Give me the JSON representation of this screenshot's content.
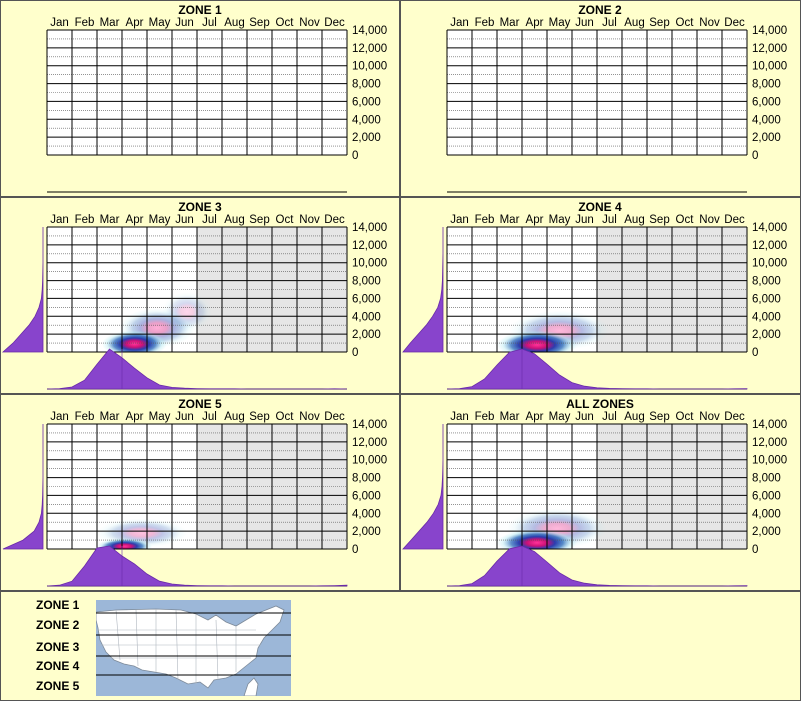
{
  "months": [
    "Jan",
    "Feb",
    "Mar",
    "Apr",
    "May",
    "Jun",
    "Jul",
    "Aug",
    "Sep",
    "Oct",
    "Nov",
    "Dec"
  ],
  "y_tick_labels": [
    "14,000",
    "12,000",
    "10,000",
    "8,000",
    "6,000",
    "4,000",
    "2,000",
    "0"
  ],
  "colors": {
    "background": "#ffffcc",
    "marginal_fill": "#8844cc",
    "shaded_months": "#e6e6e6",
    "density_low": "#aee8f0",
    "density_mid": "#1a5fb4",
    "density_high": "#ff3399"
  },
  "chart_data": [
    {
      "type": "heatmap",
      "title": "ZONE 1",
      "x_categories": [
        "Jan",
        "Feb",
        "Mar",
        "Apr",
        "May",
        "Jun",
        "Jul",
        "Aug",
        "Sep",
        "Oct",
        "Nov",
        "Dec"
      ],
      "ylim": [
        0,
        14000
      ],
      "y_ticks": [
        0,
        2000,
        4000,
        6000,
        8000,
        10000,
        12000,
        14000
      ],
      "grid": true,
      "has_data": false,
      "shaded_months": [],
      "hotspots": [],
      "month_marginal": [],
      "elevation_marginal": []
    },
    {
      "type": "heatmap",
      "title": "ZONE 2",
      "x_categories": [
        "Jan",
        "Feb",
        "Mar",
        "Apr",
        "May",
        "Jun",
        "Jul",
        "Aug",
        "Sep",
        "Oct",
        "Nov",
        "Dec"
      ],
      "ylim": [
        0,
        14000
      ],
      "y_ticks": [
        0,
        2000,
        4000,
        6000,
        8000,
        10000,
        12000,
        14000
      ],
      "grid": true,
      "has_data": false,
      "shaded_months": [],
      "hotspots": [],
      "month_marginal": [],
      "elevation_marginal": []
    },
    {
      "type": "heatmap",
      "title": "ZONE 3",
      "x_categories": [
        "Jan",
        "Feb",
        "Mar",
        "Apr",
        "May",
        "Jun",
        "Jul",
        "Aug",
        "Sep",
        "Oct",
        "Nov",
        "Dec"
      ],
      "ylim": [
        0,
        14000
      ],
      "y_ticks": [
        0,
        2000,
        4000,
        6000,
        8000,
        10000,
        12000,
        14000
      ],
      "grid": true,
      "has_data": true,
      "shaded_months": [
        "Jul",
        "Aug",
        "Sep",
        "Oct",
        "Nov",
        "Dec"
      ],
      "hotspots": [
        {
          "month": 3.5,
          "elev": 900,
          "intensity": 1.0,
          "rx": 1.3,
          "ry": 1500
        },
        {
          "month": 4.4,
          "elev": 2700,
          "intensity": 0.4,
          "rx": 1.5,
          "ry": 2200
        },
        {
          "month": 5.6,
          "elev": 4500,
          "intensity": 0.2,
          "rx": 1.0,
          "ry": 2200
        }
      ],
      "month_marginal": [
        0,
        0.01,
        0.05,
        0.22,
        0.62,
        1.0,
        0.78,
        0.52,
        0.28,
        0.1,
        0.04,
        0.02,
        0.01,
        0.005,
        0.005,
        0.005,
        0,
        0,
        0,
        0,
        0,
        0,
        0,
        0.005,
        0
      ],
      "elevation_marginal": [
        1.0,
        0.75,
        0.55,
        0.35,
        0.2,
        0.1,
        0.04,
        0.02,
        0.01,
        0.005,
        0,
        0,
        0,
        0,
        0
      ]
    },
    {
      "type": "heatmap",
      "title": "ZONE 4",
      "x_categories": [
        "Jan",
        "Feb",
        "Mar",
        "Apr",
        "May",
        "Jun",
        "Jul",
        "Aug",
        "Sep",
        "Oct",
        "Nov",
        "Dec"
      ],
      "ylim": [
        0,
        14000
      ],
      "y_ticks": [
        0,
        2000,
        4000,
        6000,
        8000,
        10000,
        12000,
        14000
      ],
      "grid": true,
      "has_data": true,
      "shaded_months": [
        "Jul",
        "Aug",
        "Sep",
        "Oct",
        "Nov",
        "Dec"
      ],
      "hotspots": [
        {
          "month": 3.6,
          "elev": 800,
          "intensity": 1.0,
          "rx": 1.6,
          "ry": 1600
        },
        {
          "month": 4.5,
          "elev": 2400,
          "intensity": 0.35,
          "rx": 2.0,
          "ry": 2200
        }
      ],
      "month_marginal": [
        0,
        0.01,
        0.06,
        0.25,
        0.6,
        0.92,
        1.0,
        0.88,
        0.62,
        0.35,
        0.16,
        0.07,
        0.03,
        0.015,
        0.01,
        0.005,
        0.005,
        0,
        0,
        0,
        0,
        0,
        0,
        0.005,
        0.01
      ],
      "elevation_marginal": [
        1.0,
        0.82,
        0.62,
        0.42,
        0.26,
        0.13,
        0.06,
        0.03,
        0.015,
        0.01,
        0.005,
        0,
        0,
        0,
        0
      ]
    },
    {
      "type": "heatmap",
      "title": "ZONE 5",
      "x_categories": [
        "Jan",
        "Feb",
        "Mar",
        "Apr",
        "May",
        "Jun",
        "Jul",
        "Aug",
        "Sep",
        "Oct",
        "Nov",
        "Dec"
      ],
      "ylim": [
        0,
        14000
      ],
      "y_ticks": [
        0,
        2000,
        4000,
        6000,
        8000,
        10000,
        12000,
        14000
      ],
      "grid": true,
      "has_data": true,
      "shaded_months": [
        "Jul",
        "Aug",
        "Sep",
        "Oct",
        "Nov",
        "Dec"
      ],
      "hotspots": [
        {
          "month": 3.1,
          "elev": 300,
          "intensity": 1.0,
          "rx": 1.1,
          "ry": 900
        },
        {
          "month": 3.8,
          "elev": 1800,
          "intensity": 0.3,
          "rx": 1.8,
          "ry": 1600
        }
      ],
      "month_marginal": [
        0,
        0.02,
        0.12,
        0.5,
        0.95,
        1.0,
        0.75,
        0.55,
        0.3,
        0.12,
        0.05,
        0.02,
        0.01,
        0.005,
        0.005,
        0,
        0,
        0,
        0,
        0,
        0,
        0,
        0.005,
        0.01,
        0.02
      ],
      "elevation_marginal": [
        1.0,
        0.5,
        0.22,
        0.1,
        0.04,
        0.02,
        0.01,
        0.005,
        0,
        0,
        0,
        0,
        0,
        0,
        0
      ]
    },
    {
      "type": "heatmap",
      "title": "ALL ZONES",
      "x_categories": [
        "Jan",
        "Feb",
        "Mar",
        "Apr",
        "May",
        "Jun",
        "Jul",
        "Aug",
        "Sep",
        "Oct",
        "Nov",
        "Dec"
      ],
      "ylim": [
        0,
        14000
      ],
      "y_ticks": [
        0,
        2000,
        4000,
        6000,
        8000,
        10000,
        12000,
        14000
      ],
      "grid": true,
      "has_data": true,
      "shaded_months": [
        "Jul",
        "Aug",
        "Sep",
        "Oct",
        "Nov",
        "Dec"
      ],
      "hotspots": [
        {
          "month": 3.6,
          "elev": 700,
          "intensity": 1.0,
          "rx": 1.6,
          "ry": 1500
        },
        {
          "month": 4.4,
          "elev": 2300,
          "intensity": 0.35,
          "rx": 2.0,
          "ry": 2200
        }
      ],
      "month_marginal": [
        0,
        0.01,
        0.06,
        0.26,
        0.62,
        0.93,
        1.0,
        0.86,
        0.6,
        0.33,
        0.15,
        0.07,
        0.03,
        0.015,
        0.01,
        0.005,
        0.005,
        0,
        0,
        0,
        0,
        0,
        0,
        0.005,
        0.01
      ],
      "elevation_marginal": [
        1.0,
        0.8,
        0.6,
        0.4,
        0.24,
        0.12,
        0.05,
        0.025,
        0.012,
        0.006,
        0,
        0,
        0,
        0,
        0
      ]
    }
  ],
  "legend": {
    "zones": [
      "ZONE 1",
      "ZONE 2",
      "ZONE 3",
      "ZONE 4",
      "ZONE 5"
    ]
  }
}
